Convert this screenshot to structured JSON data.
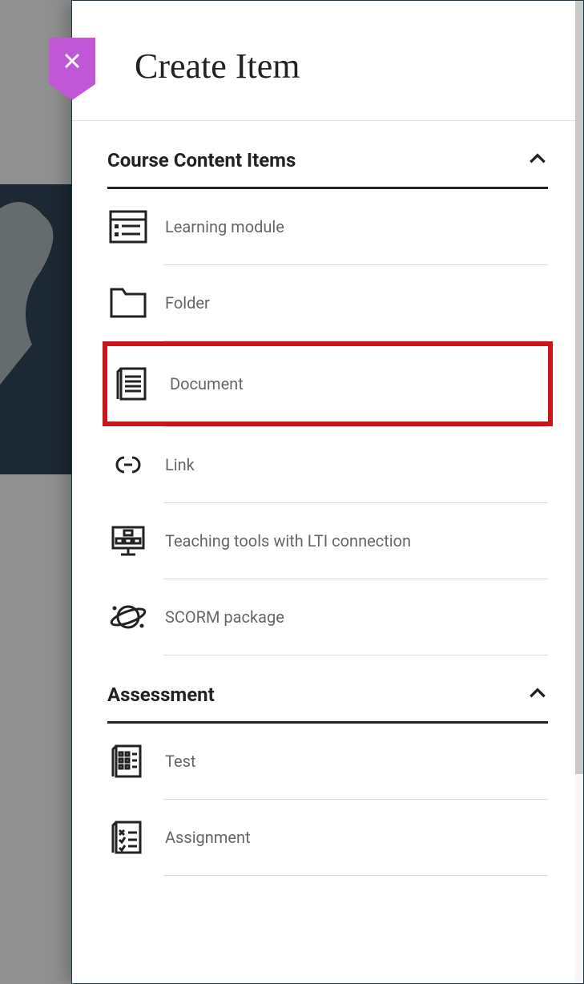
{
  "panel": {
    "title": "Create Item"
  },
  "sections": {
    "course_content": {
      "title": "Course Content Items",
      "expanded": true,
      "items": {
        "learning_module": "Learning module",
        "folder": "Folder",
        "document": "Document",
        "link": "Link",
        "lti": "Teaching tools with LTI connection",
        "scorm": "SCORM package"
      }
    },
    "assessment": {
      "title": "Assessment",
      "expanded": true,
      "items": {
        "test": "Test",
        "assignment": "Assignment"
      }
    }
  }
}
